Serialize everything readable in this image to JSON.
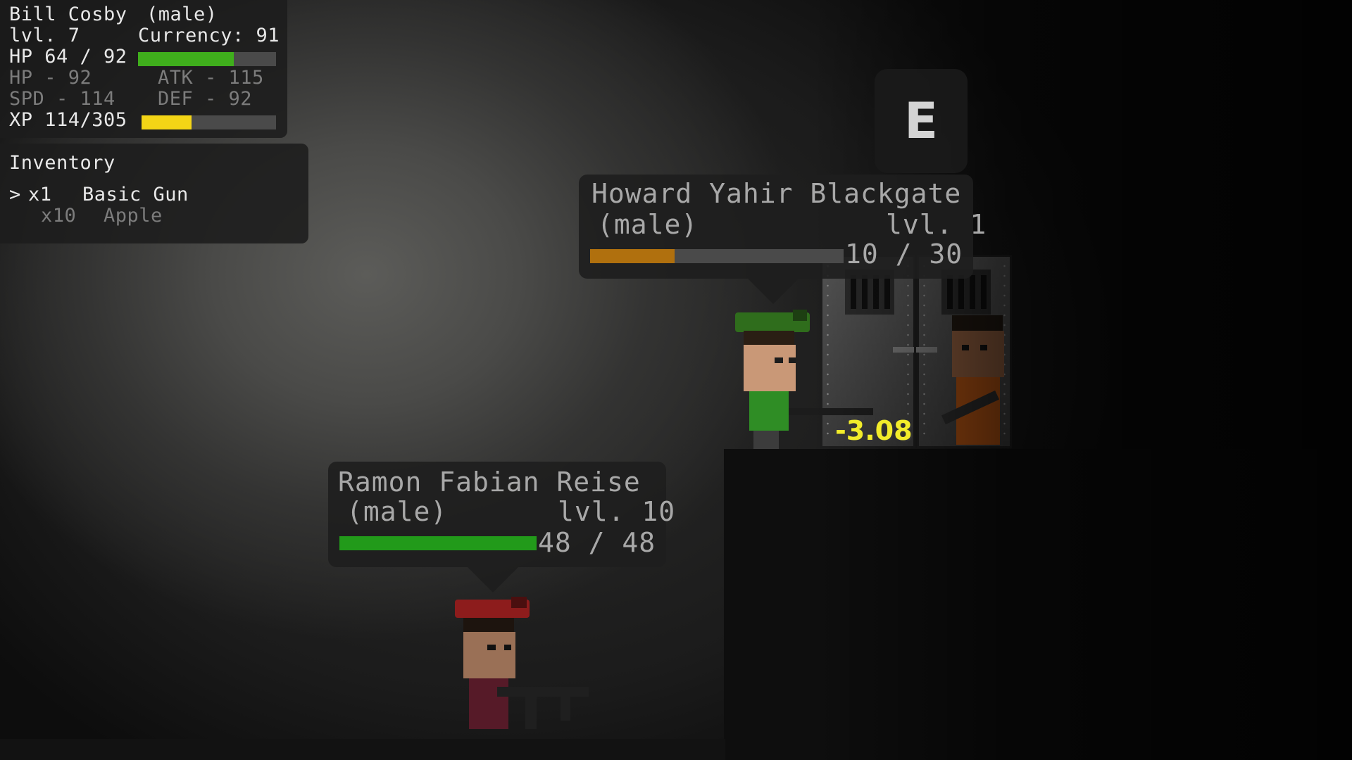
{
  "player": {
    "name": "Bill Cosby",
    "gender": "(male)",
    "level": "lvl. 7",
    "currency": "Currency: 91",
    "hp_text": "HP 64 / 92",
    "hp_fraction": 0.6957,
    "stat_hp": "HP - 92",
    "stat_atk": "ATK - 115",
    "stat_spd": "SPD - 114",
    "stat_def": "DEF - 92",
    "xp_text": "XP 114/305",
    "xp_fraction": 0.3738
  },
  "inventory": {
    "title": "Inventory",
    "items": [
      {
        "cursor": ">",
        "qty": "x1",
        "name": "Basic Gun",
        "selected": true
      },
      {
        "cursor": "",
        "qty": "x10",
        "name": "Apple",
        "selected": false
      }
    ]
  },
  "interact_key": "E",
  "npcs": [
    {
      "name": "Howard Yahir Blackgate",
      "gender": "(male)",
      "level": "lvl. 1",
      "hp_text": "10 / 30",
      "hp_fraction": 0.3333,
      "bar_color": "#b0700e"
    },
    {
      "name": "Ramon Fabian Reise",
      "gender": "(male)",
      "level": "lvl. 10",
      "hp_text": "48 / 48",
      "hp_fraction": 1.0,
      "bar_color": "#229a1a"
    }
  ],
  "damage_popup": "-3.08",
  "colors": {
    "hp_bar": "#3fae1c",
    "xp_bar": "#f4d516",
    "damage": "#f2ec2a"
  }
}
